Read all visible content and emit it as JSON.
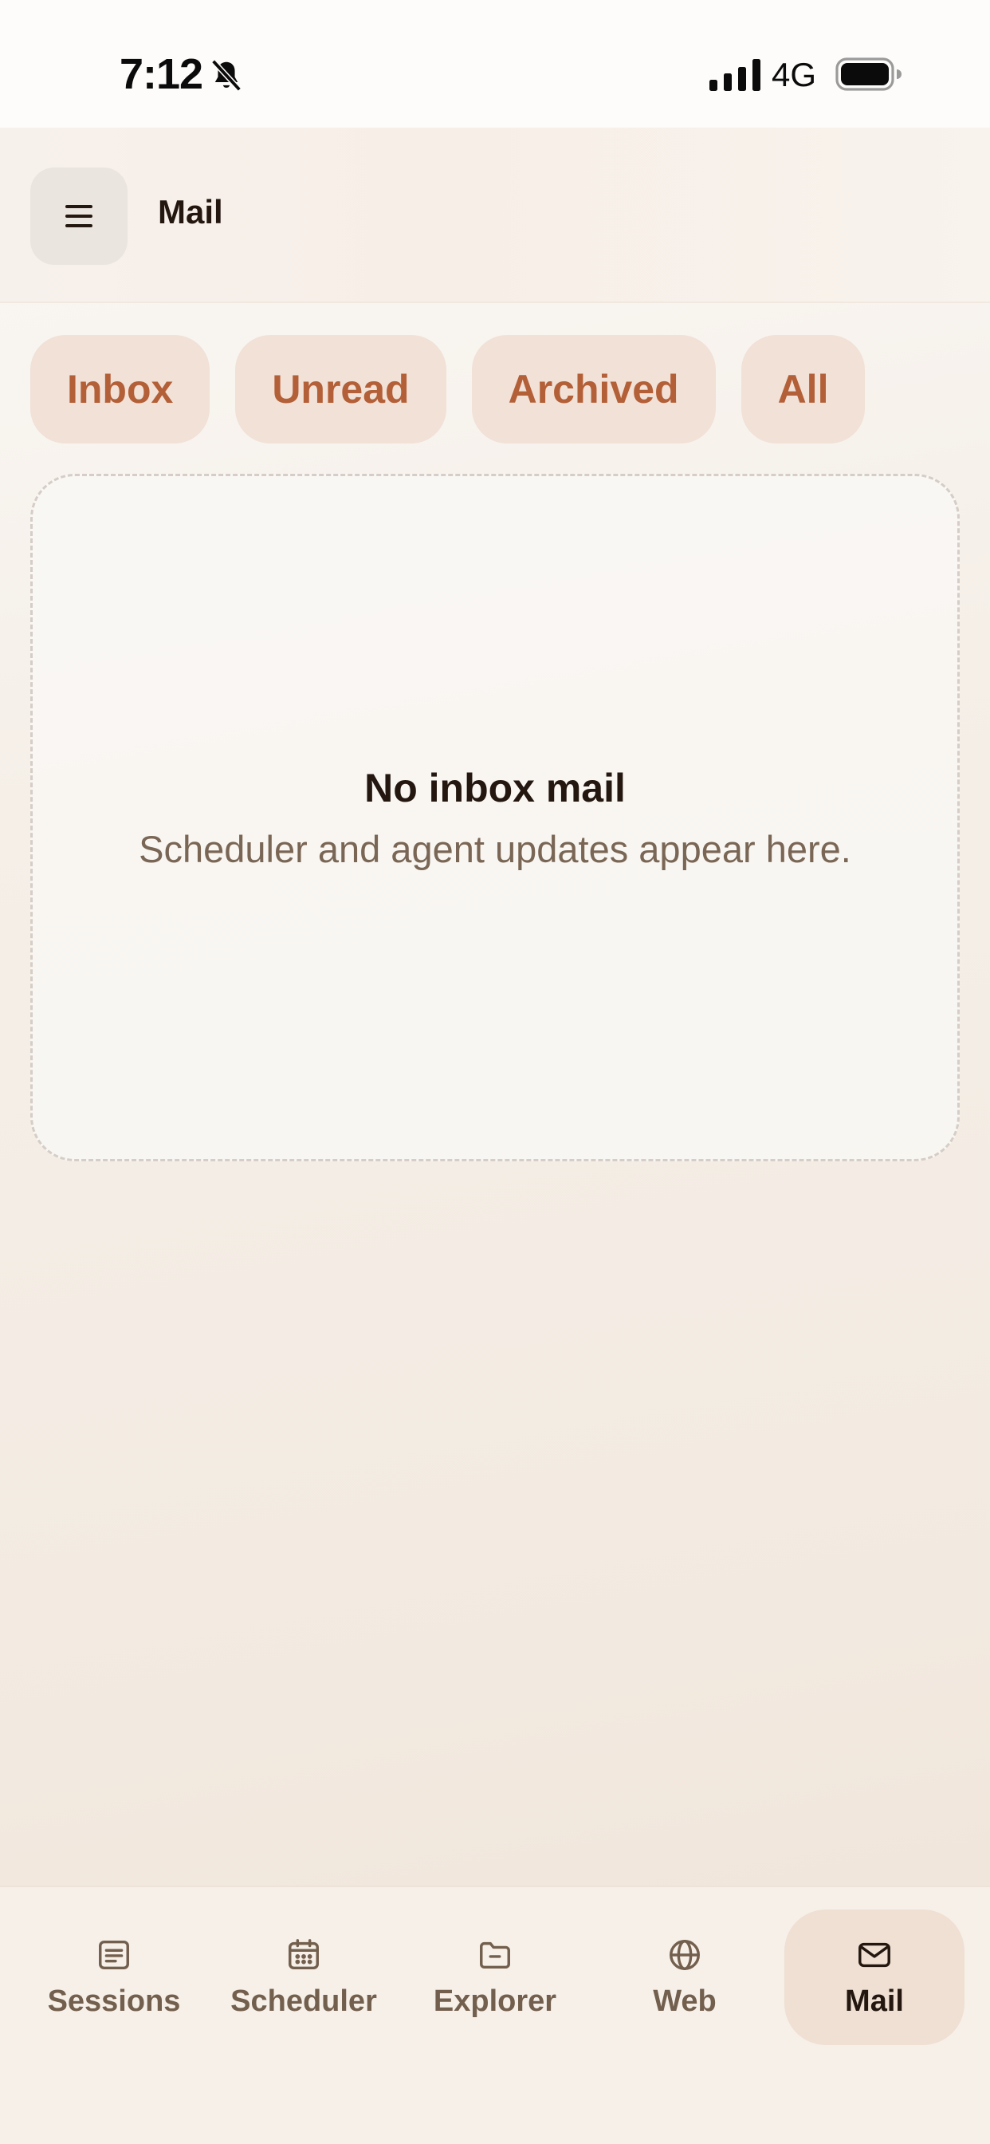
{
  "status_bar": {
    "time": "7:12",
    "network": "4G",
    "icons": [
      "bell-slash-icon",
      "signal-icon",
      "battery-icon"
    ]
  },
  "header": {
    "menu_icon": "hamburger-icon",
    "title": "Mail"
  },
  "tabs": [
    {
      "label": "Inbox"
    },
    {
      "label": "Unread"
    },
    {
      "label": "Archived"
    },
    {
      "label": "All"
    }
  ],
  "empty_state": {
    "title": "No inbox mail",
    "subtitle": "Scheduler and agent updates appear here."
  },
  "bottom_nav": {
    "items": [
      {
        "label": "Sessions",
        "icon": "list-icon",
        "active": false
      },
      {
        "label": "Scheduler",
        "icon": "calendar-icon",
        "active": false
      },
      {
        "label": "Explorer",
        "icon": "folder-icon",
        "active": false
      },
      {
        "label": "Web",
        "icon": "globe-icon",
        "active": false
      },
      {
        "label": "Mail",
        "icon": "mail-icon",
        "active": true
      }
    ]
  },
  "colors": {
    "accent": "#b35f37",
    "tab_bg": "#f1e1d7",
    "active_nav_bg": "#efe0d3",
    "text_primary": "#23170f",
    "text_muted": "#7a6655"
  }
}
